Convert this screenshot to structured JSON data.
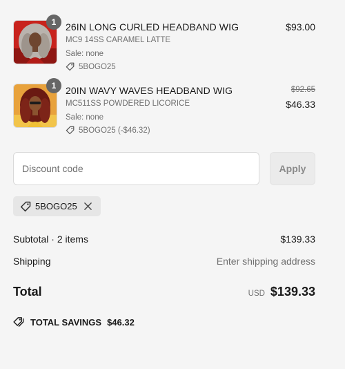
{
  "items": [
    {
      "quantity": "1",
      "title": "26IN LONG CURLED HEADBAND WIG",
      "variant": "MC9 14SS CARAMEL LATTE",
      "sale": "Sale: none",
      "discount": "5BOGO25",
      "price": "$93.00"
    },
    {
      "quantity": "1",
      "title": "20IN WAVY WAVES HEADBAND WIG",
      "variant": "MC511SS POWDERED LICORICE",
      "sale": "Sale: none",
      "discount": "5BOGO25 (-$46.32)",
      "original_price": "$92.65",
      "price": "$46.33"
    }
  ],
  "discount_form": {
    "placeholder": "Discount code",
    "apply_label": "Apply"
  },
  "applied_code": "5BOGO25",
  "summary": {
    "subtotal_label": "Subtotal · 2 items",
    "subtotal_value": "$139.33",
    "shipping_label": "Shipping",
    "shipping_value": "Enter shipping address",
    "total_label": "Total",
    "currency": "USD",
    "total_value": "$139.33"
  },
  "savings": {
    "label": "TOTAL SAVINGS",
    "value": "$46.32"
  },
  "icons": {
    "tag": "tag-icon",
    "close": "close-icon",
    "savings": "tags-icon"
  },
  "colors": {
    "background": "#f5f5f5",
    "text": "#1a1a1a",
    "muted": "#707070",
    "quantity_badge": "#666666",
    "chip": "#e6e6e6"
  }
}
